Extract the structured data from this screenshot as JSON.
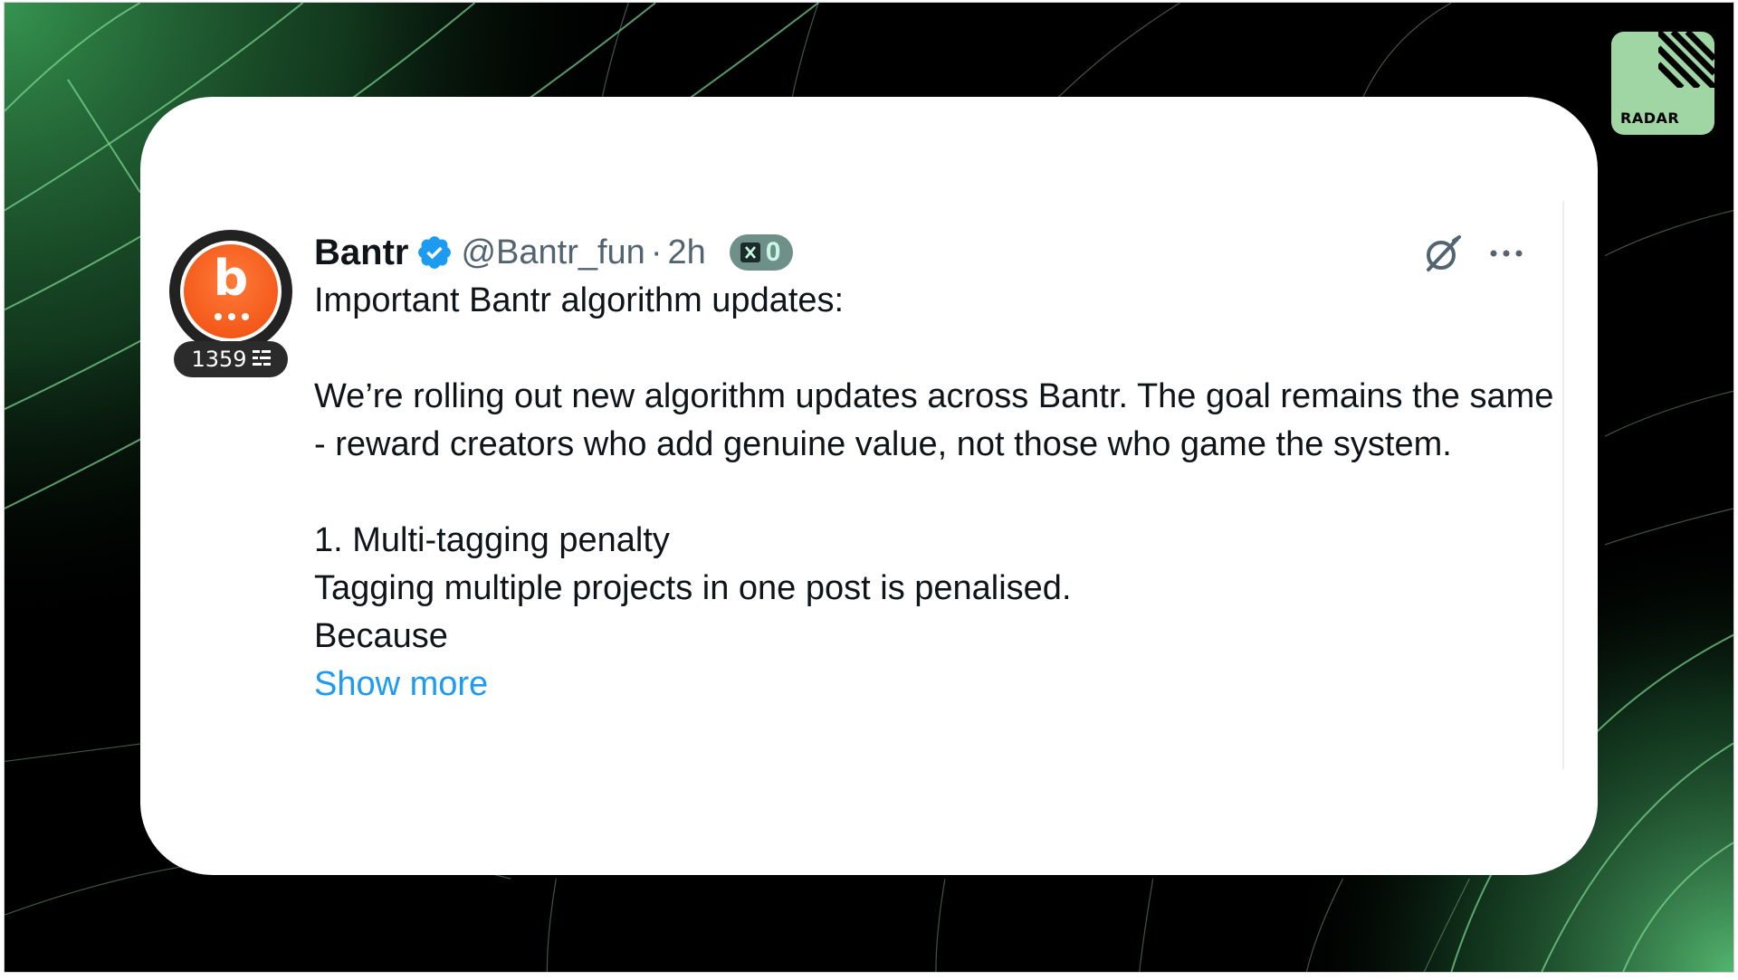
{
  "brand": {
    "logo_label": "RADAR",
    "accent_green": "#9fd6a4",
    "background": "#000000"
  },
  "post": {
    "author": {
      "name": "Bantr",
      "handle": "@Bantr_fun",
      "verified": true,
      "avatar_letter": "b",
      "avatar_color": "#f45a1a",
      "score": "1359"
    },
    "time_separator": "·",
    "time": "2h",
    "x_badge_count": "0",
    "icons": [
      "grok-icon",
      "more-icon"
    ],
    "lines": [
      "Important Bantr algorithm updates:",
      "",
      "We’re rolling out new algorithm updates across Bantr. The goal remains the same - reward creators who add genuine value, not those who game the system.",
      "",
      "1. Multi-tagging penalty",
      "Tagging multiple projects in one post is penalised.",
      "Because"
    ],
    "show_more_label": "Show more",
    "link_color": "#1d9bf0"
  }
}
